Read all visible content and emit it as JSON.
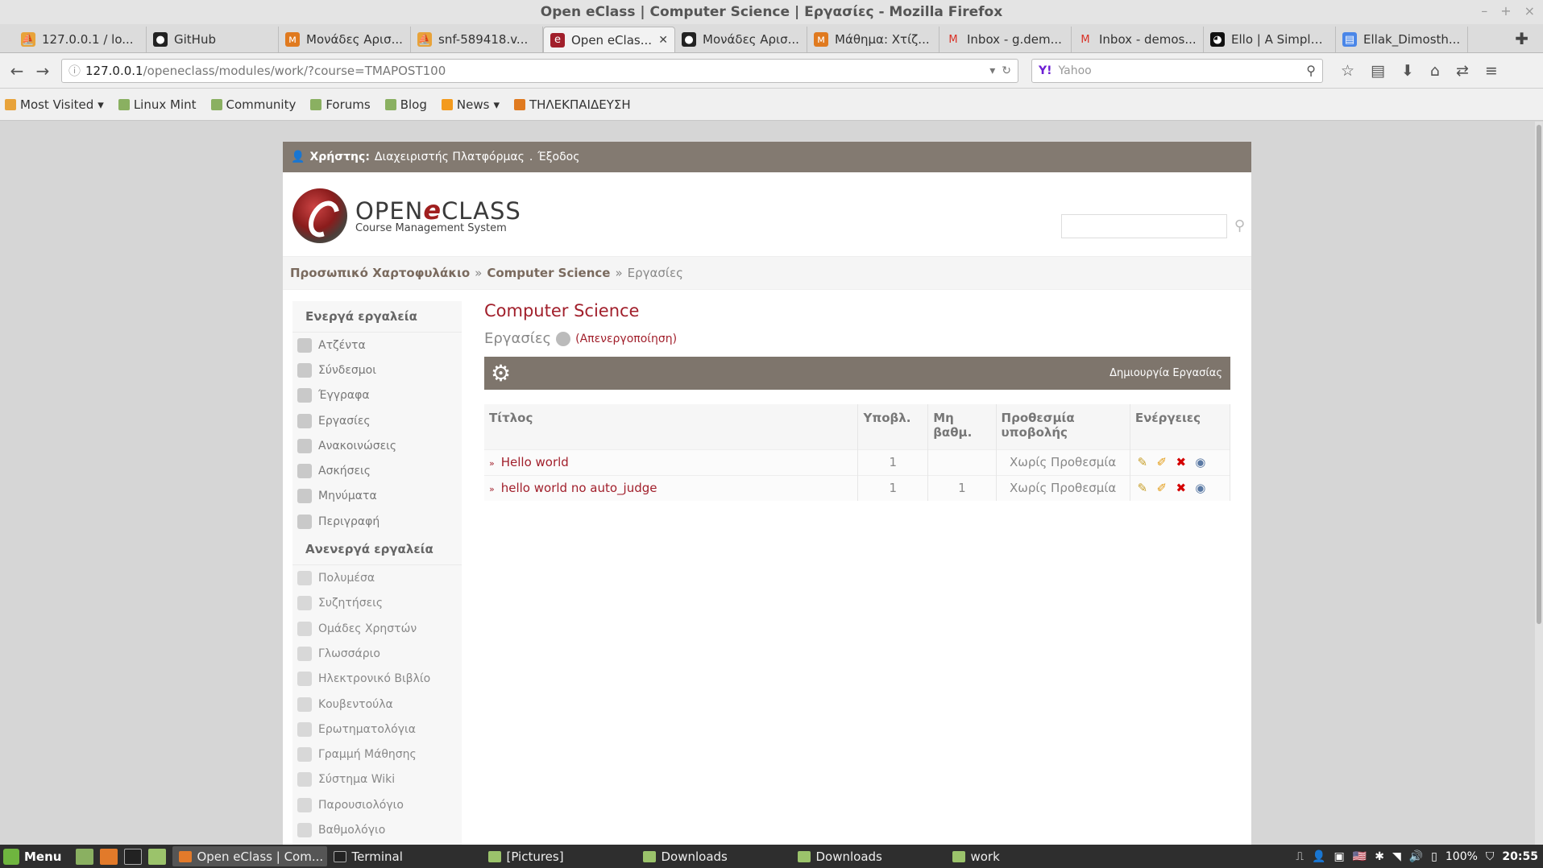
{
  "window": {
    "title": "Open eClass | Computer Science | Εργασίες - Mozilla Firefox"
  },
  "tabs": [
    {
      "label": "127.0.0.1 / lo...",
      "icon": "phpmyadmin-icon",
      "active": false
    },
    {
      "label": "GitHub",
      "icon": "github-icon",
      "active": false
    },
    {
      "label": "Μονάδες Αρισ...",
      "icon": "eclass-icon",
      "active": false
    },
    {
      "label": "snf-589418.v...",
      "icon": "phpmyadmin-icon",
      "active": false
    },
    {
      "label": "Open eClas...",
      "icon": "eclass-logo-icon",
      "active": true
    },
    {
      "label": "Μονάδες Αρισ...",
      "icon": "github-icon",
      "active": false
    },
    {
      "label": "Μάθημα: Χτίζ...",
      "icon": "eclass-icon",
      "active": false
    },
    {
      "label": "Inbox - g.dem...",
      "icon": "gmail-icon",
      "active": false
    },
    {
      "label": "Inbox - demos...",
      "icon": "gmail-icon",
      "active": false
    },
    {
      "label": "Ello | A Simple...",
      "icon": "ello-icon",
      "active": false
    },
    {
      "label": "Ellak_Dimosth...",
      "icon": "docs-icon",
      "active": false
    }
  ],
  "url": {
    "host": "127.0.0.1",
    "path": "/openeclass/modules/work/?course=TMAPOST100"
  },
  "search": {
    "placeholder": "Yahoo",
    "engine": "Y!"
  },
  "bookmarks": [
    {
      "label": "Most Visited",
      "dropdown": true
    },
    {
      "label": "Linux Mint",
      "dropdown": false
    },
    {
      "label": "Community",
      "dropdown": false
    },
    {
      "label": "Forums",
      "dropdown": false
    },
    {
      "label": "Blog",
      "dropdown": false
    },
    {
      "label": "News",
      "dropdown": true
    },
    {
      "label": "ΤΗΛΕΚΠΑΙΔΕΥΣΗ",
      "dropdown": false
    }
  ],
  "userbar": {
    "label": "Χρήστης:",
    "name": "Διαχειριστής Πλατφόρμας",
    "separator": ".",
    "logout": "Έξοδος"
  },
  "logo": {
    "open": "OPEN",
    "e": "e",
    "class": "CLASS",
    "subtitle": "Course Management System"
  },
  "breadcrumb": {
    "home": "Προσωπικό Χαρτοφυλάκιο",
    "sep": "»",
    "course": "Computer Science",
    "current": "Εργασίες"
  },
  "sidebar": {
    "active_title": "Ενεργά εργαλεία",
    "active_items": [
      "Ατζέντα",
      "Σύνδεσμοι",
      "Έγγραφα",
      "Εργασίες",
      "Ανακοινώσεις",
      "Ασκήσεις",
      "Μηνύματα",
      "Περιγραφή"
    ],
    "inactive_title": "Ανενεργά εργαλεία",
    "inactive_items": [
      "Πολυμέσα",
      "Συζητήσεις",
      "Ομάδες Χρηστών",
      "Γλωσσάριο",
      "Ηλεκτρονικό Βιβλίο",
      "Κουβεντούλα",
      "Ερωτηματολόγια",
      "Γραμμή Μάθησης",
      "Σύστημα Wiki",
      "Παρουσιολόγιο",
      "Βαθμολόγιο"
    ]
  },
  "content": {
    "course_title": "Computer Science",
    "section": "Εργασίες",
    "deactivate": "(Απενεργοποίηση)",
    "create_label": "Δημιουργία Εργασίας"
  },
  "table": {
    "headers": [
      "Τίτλος",
      "Υποβλ.",
      "Μη βαθμ.",
      "Προθεσμία υποβολής",
      "Ενέργειες"
    ],
    "rows": [
      {
        "title": "Hello world",
        "submissions": "1",
        "ungraded": "",
        "deadline": "Χωρίς Προθεσμία"
      },
      {
        "title": "hello world no auto_judge",
        "submissions": "1",
        "ungraded": "1",
        "deadline": "Χωρίς Προθεσμία"
      }
    ]
  },
  "taskbar": {
    "menu": "Menu",
    "windows": [
      {
        "label": "Open eClass | Com...",
        "active": true
      },
      {
        "label": "Terminal",
        "active": false
      },
      {
        "label": "[Pictures]",
        "active": false
      },
      {
        "label": "Downloads",
        "active": false
      },
      {
        "label": "Downloads",
        "active": false
      },
      {
        "label": "work",
        "active": false
      }
    ],
    "battery": "100%",
    "clock": "20:55"
  },
  "colors": {
    "accent": "#a11f2b",
    "bar": "#7e756c"
  }
}
